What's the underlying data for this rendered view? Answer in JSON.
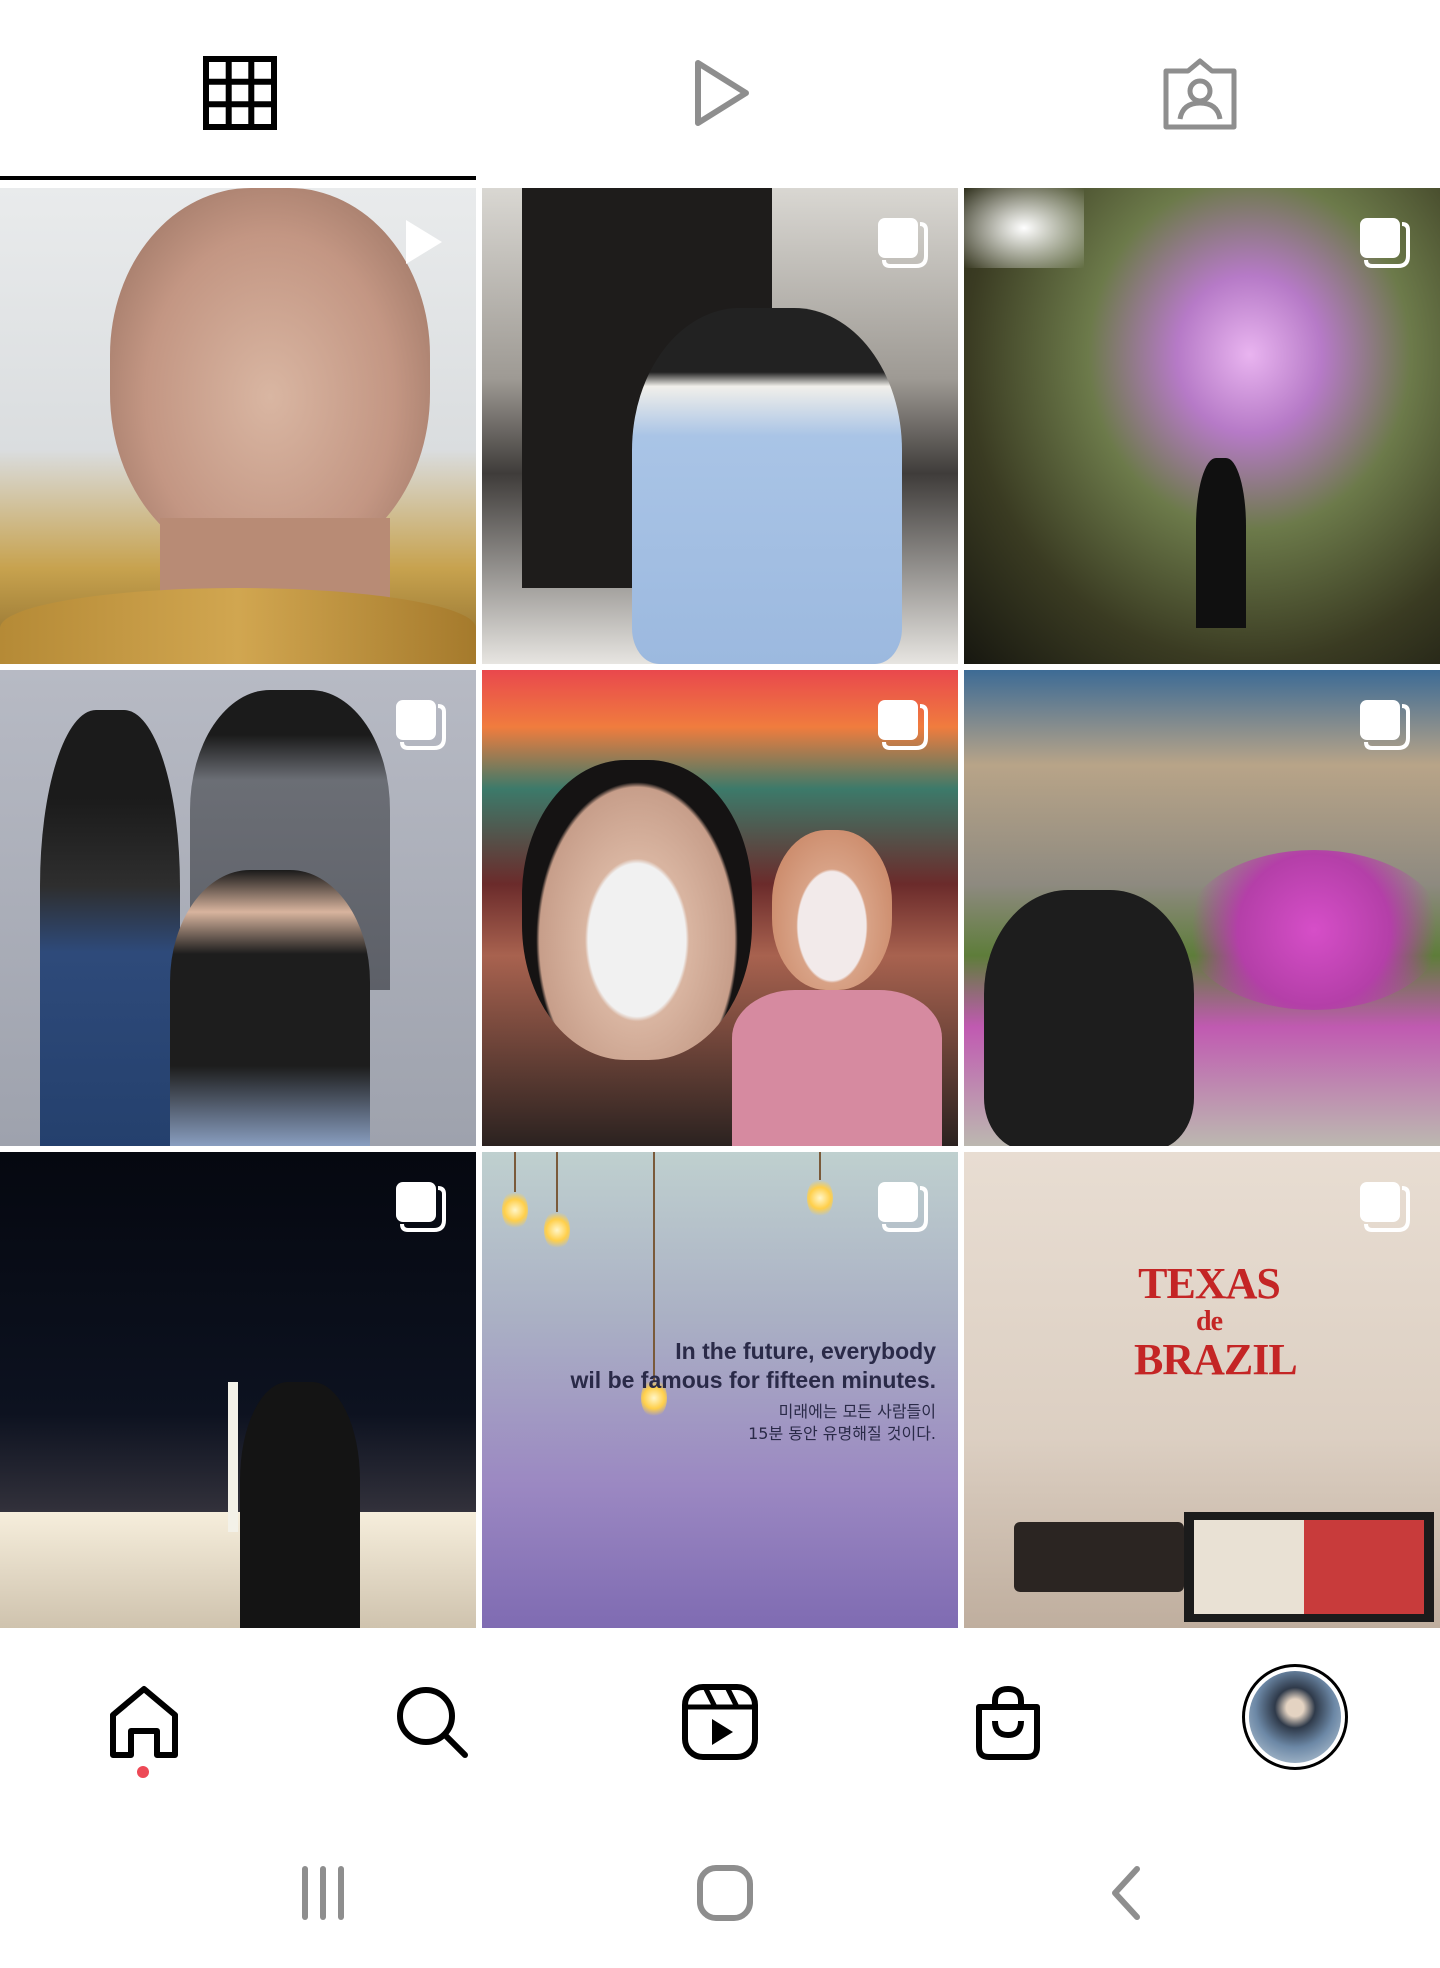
{
  "tabs": [
    {
      "id": "posts",
      "icon": "grid-icon",
      "selected": true
    },
    {
      "id": "reels",
      "icon": "play-icon",
      "selected": false
    },
    {
      "id": "tagged",
      "icon": "tagged-person-icon",
      "selected": false
    }
  ],
  "posts": [
    {
      "type": "video",
      "badge_icon": "play-icon"
    },
    {
      "type": "carousel",
      "badge_icon": "carousel-icon"
    },
    {
      "type": "carousel",
      "badge_icon": "carousel-icon"
    },
    {
      "type": "carousel",
      "badge_icon": "carousel-icon"
    },
    {
      "type": "carousel",
      "badge_icon": "carousel-icon"
    },
    {
      "type": "carousel",
      "badge_icon": "carousel-icon"
    },
    {
      "type": "carousel",
      "badge_icon": "carousel-icon"
    },
    {
      "type": "carousel",
      "badge_icon": "carousel-icon",
      "quote_en_line1": "In the future, everybody",
      "quote_en_line2": "wil  be famous for fifteen minutes.",
      "quote_ko_line1": "미래에는 모든 사람들이",
      "quote_ko_line2": "15분 동안 유명해질 것이다."
    },
    {
      "type": "carousel",
      "badge_icon": "carousel-icon",
      "sign_line1": "TEXAS",
      "sign_line2": "de",
      "sign_line3": "BRAZIL"
    }
  ],
  "bottom_nav": [
    {
      "id": "home",
      "icon": "home-icon",
      "active": true,
      "has_notification_dot": true
    },
    {
      "id": "search",
      "icon": "search-icon"
    },
    {
      "id": "reels",
      "icon": "reels-icon"
    },
    {
      "id": "shop",
      "icon": "shopping-bag-icon"
    },
    {
      "id": "profile",
      "icon": "profile-avatar"
    }
  ],
  "system_nav": [
    "recent-apps-icon",
    "home-circle-icon",
    "back-chevron-icon"
  ],
  "colors": {
    "tab_indicator": "#000000",
    "notification_dot": "#ed4956",
    "icon": "#262626",
    "system_icon": "#8e8e8e"
  }
}
